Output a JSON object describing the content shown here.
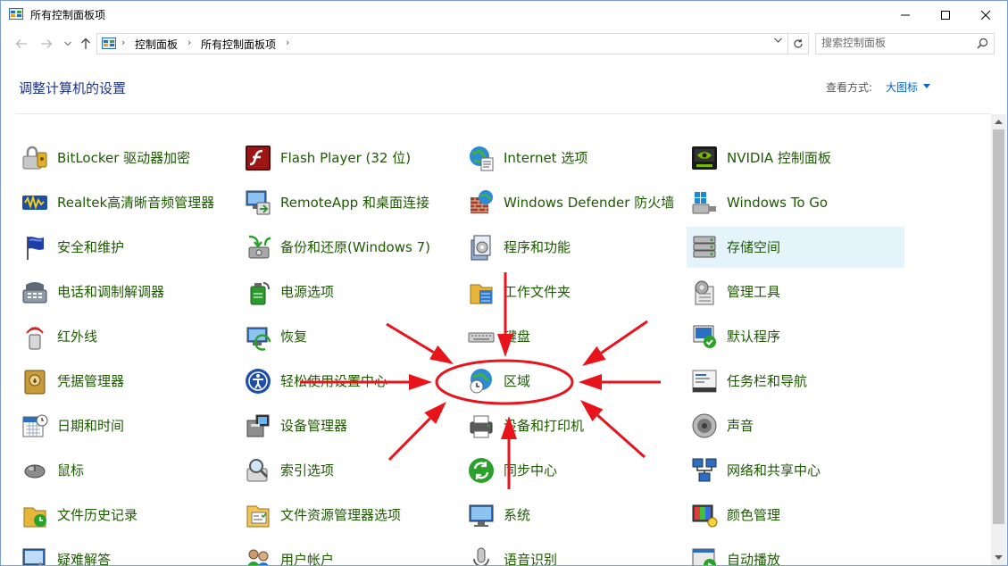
{
  "window": {
    "title": "所有控制面板项",
    "minimize_glyph": "—",
    "maximize_glyph": "☐",
    "close_glyph": "✕"
  },
  "address_bar": {
    "crumbs": [
      "控制面板",
      "所有控制面板项"
    ]
  },
  "search": {
    "placeholder": "搜索控制面板"
  },
  "header": {
    "title": "调整计算机的设置",
    "view_by_label": "查看方式:",
    "view_by_value": "大图标"
  },
  "colors": {
    "heading": "#1e3287",
    "item_text": "#1c5a00",
    "link": "#0066cc",
    "selection": "#e5f3fb",
    "annotation": "#e8141b"
  },
  "items": [
    {
      "label": "BitLocker 驱动器加密",
      "icon": "bitlocker-icon"
    },
    {
      "label": "Flash Player (32 位)",
      "icon": "flash-player-icon"
    },
    {
      "label": "Internet 选项",
      "icon": "internet-options-icon"
    },
    {
      "label": "NVIDIA 控制面板",
      "icon": "nvidia-icon"
    },
    {
      "label": "Realtek高清晰音频管理器",
      "icon": "realtek-audio-icon"
    },
    {
      "label": "RemoteApp 和桌面连接",
      "icon": "remoteapp-icon"
    },
    {
      "label": "Windows Defender 防火墙",
      "icon": "firewall-icon"
    },
    {
      "label": "Windows To Go",
      "icon": "windows-to-go-icon"
    },
    {
      "label": "安全和维护",
      "icon": "security-maintenance-icon"
    },
    {
      "label": "备份和还原(Windows 7)",
      "icon": "backup-restore-icon"
    },
    {
      "label": "程序和功能",
      "icon": "programs-features-icon"
    },
    {
      "label": "存储空间",
      "icon": "storage-spaces-icon",
      "selected": true
    },
    {
      "label": "电话和调制解调器",
      "icon": "phone-modem-icon"
    },
    {
      "label": "电源选项",
      "icon": "power-options-icon"
    },
    {
      "label": "工作文件夹",
      "icon": "work-folders-icon"
    },
    {
      "label": "管理工具",
      "icon": "admin-tools-icon"
    },
    {
      "label": "红外线",
      "icon": "infrared-icon"
    },
    {
      "label": "恢复",
      "icon": "recovery-icon"
    },
    {
      "label": "键盘",
      "icon": "keyboard-icon"
    },
    {
      "label": "默认程序",
      "icon": "default-programs-icon"
    },
    {
      "label": "凭据管理器",
      "icon": "credential-manager-icon"
    },
    {
      "label": "轻松使用设置中心",
      "icon": "ease-of-access-icon"
    },
    {
      "label": "区域",
      "icon": "region-icon"
    },
    {
      "label": "任务栏和导航",
      "icon": "taskbar-icon"
    },
    {
      "label": "日期和时间",
      "icon": "date-time-icon"
    },
    {
      "label": "设备管理器",
      "icon": "device-manager-icon"
    },
    {
      "label": "设备和打印机",
      "icon": "devices-printers-icon"
    },
    {
      "label": "声音",
      "icon": "sound-icon"
    },
    {
      "label": "鼠标",
      "icon": "mouse-icon"
    },
    {
      "label": "索引选项",
      "icon": "indexing-icon"
    },
    {
      "label": "同步中心",
      "icon": "sync-center-icon"
    },
    {
      "label": "网络和共享中心",
      "icon": "network-sharing-icon"
    },
    {
      "label": "文件历史记录",
      "icon": "file-history-icon"
    },
    {
      "label": "文件资源管理器选项",
      "icon": "explorer-options-icon"
    },
    {
      "label": "系统",
      "icon": "system-icon"
    },
    {
      "label": "颜色管理",
      "icon": "color-management-icon"
    },
    {
      "label": "疑难解答",
      "icon": "troubleshooting-icon"
    },
    {
      "label": "用户帐户",
      "icon": "user-accounts-icon"
    },
    {
      "label": "语音识别",
      "icon": "speech-recognition-icon"
    },
    {
      "label": "自动播放",
      "icon": "autoplay-icon"
    }
  ],
  "annotation": {
    "shape": "red ellipse with eight arrows pointing at 区域",
    "target": "区域"
  }
}
